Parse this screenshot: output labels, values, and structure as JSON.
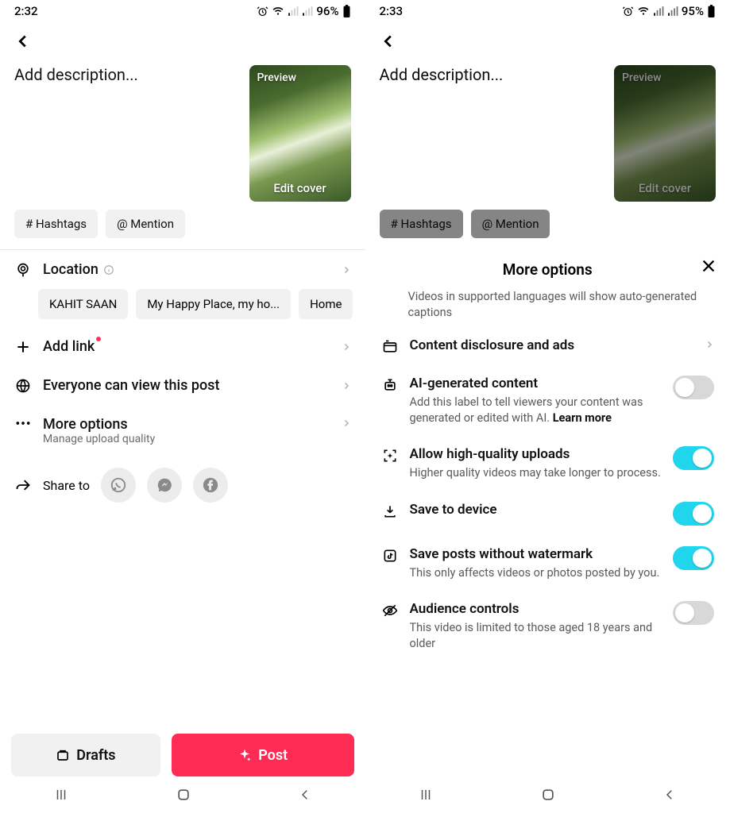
{
  "left": {
    "status_time": "2:32",
    "battery": "96%",
    "description_placeholder": "Add description...",
    "preview_label": "Preview",
    "edit_cover_label": "Edit cover",
    "chips": {
      "hashtags": "# Hashtags",
      "mention": "@ Mention"
    },
    "location_label": "Location",
    "location_chips": [
      "KAHIT SAAN",
      "My Happy Place, my ho...",
      "Home"
    ],
    "add_link_label": "Add link",
    "visibility_label": "Everyone can view this post",
    "more_options_label": "More options",
    "more_options_sub": "Manage upload quality",
    "share_label": "Share to",
    "drafts_label": "Drafts",
    "post_label": "Post"
  },
  "right": {
    "status_time": "2:33",
    "battery": "95%",
    "description_placeholder": "Add description...",
    "preview_label": "Preview",
    "edit_cover_label": "Edit cover",
    "chips": {
      "hashtags": "# Hashtags",
      "mention": "@ Mention"
    },
    "sheet_title": "More options",
    "captions_intro": "Videos in supported languages will show auto-generated captions",
    "items": {
      "disclosure": "Content disclosure and ads",
      "ai_title": "AI-generated content",
      "ai_sub": "Add this label to tell viewers your content was generated or edited with AI. ",
      "ai_learn": "Learn more",
      "hq_title": "Allow high-quality uploads",
      "hq_sub": "Higher quality videos may take longer to process.",
      "save_device": "Save to device",
      "watermark_title": "Save posts without watermark",
      "watermark_sub": "This only affects videos or photos posted by you.",
      "audience_title": "Audience controls",
      "audience_sub": "This video is limited to those aged 18 years and older"
    },
    "toggles": {
      "ai": false,
      "hq": true,
      "save_device": true,
      "watermark": true,
      "audience": false
    }
  }
}
